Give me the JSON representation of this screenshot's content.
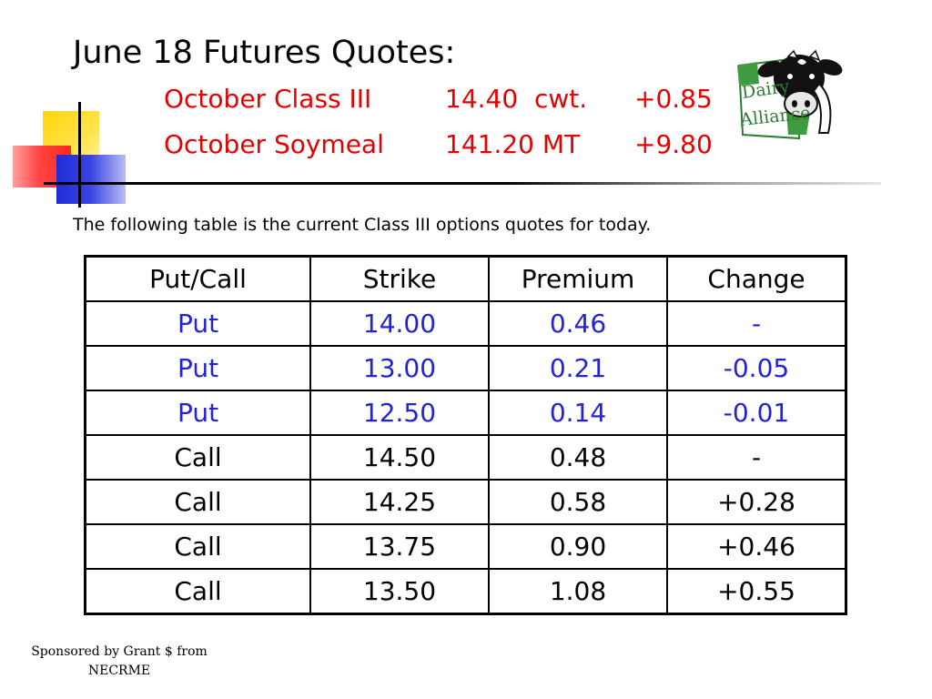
{
  "title": "June 18 Futures Quotes:",
  "futures": [
    {
      "name": "October Class III",
      "value": "14.40  cwt.",
      "change": "+0.85"
    },
    {
      "name": "October Soymeal",
      "value": "141.20 MT",
      "change": "+9.80"
    }
  ],
  "logo": {
    "line1": "Dairy",
    "line2": "Alliance",
    "icon": "cow-head-icon"
  },
  "intro": "The following table is the current Class III options quotes for today.",
  "table": {
    "headers": [
      "Put/Call",
      "Strike",
      "Premium",
      "Change"
    ],
    "rows": [
      [
        "Put",
        "14.00",
        "0.46",
        "-"
      ],
      [
        "Put",
        "13.00",
        "0.21",
        "-0.05"
      ],
      [
        "Put",
        "12.50",
        "0.14",
        "-0.01"
      ],
      [
        "Call",
        "14.50",
        "0.48",
        "-"
      ],
      [
        "Call",
        "14.25",
        "0.58",
        "+0.28"
      ],
      [
        "Call",
        "13.75",
        "0.90",
        "+0.46"
      ],
      [
        "Call",
        "13.50",
        "1.08",
        "+0.55"
      ]
    ]
  },
  "footer": {
    "line1": "Sponsored by Grant $ from",
    "line2": "NECRME"
  },
  "colors": {
    "futures_text": "#e60000",
    "put_rows": "#2323d6",
    "logo_green": "#2e7d32"
  }
}
